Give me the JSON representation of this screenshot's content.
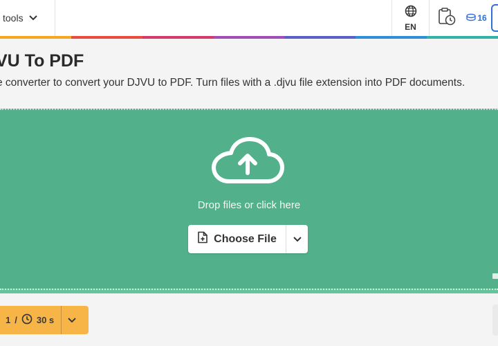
{
  "header": {
    "tools_label": "l tools",
    "language_code": "EN",
    "credits_count": "16"
  },
  "page": {
    "title": "VU To PDF",
    "description": "e converter to convert your DJVU to PDF. Turn files with a .djvu file extension into PDF documents."
  },
  "upload": {
    "drop_text": "Drop files or click here",
    "choose_label": "Choose File"
  },
  "limits": {
    "files_count": "1",
    "separator": "/",
    "time_limit": "30 s"
  },
  "colors": {
    "dropzone": "#52b08a",
    "accent_blue": "#2f6fd6",
    "limits_bar": "#f7b548",
    "rainbow": [
      "#f5a623",
      "#e94b3c",
      "#d63a6b",
      "#a14fb8",
      "#5b5fc7",
      "#2f8fd6",
      "#33b3a6"
    ]
  },
  "icons": [
    "chevron-down-icon",
    "globe-icon",
    "clipboard-clock-icon",
    "coins-icon",
    "cloud-upload-icon",
    "file-add-icon",
    "clock-icon"
  ]
}
